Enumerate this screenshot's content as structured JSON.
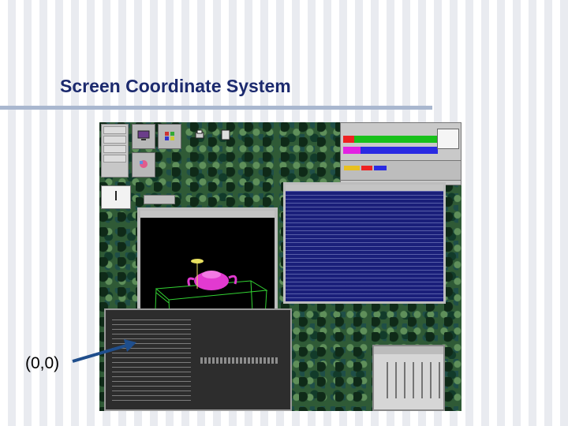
{
  "slide": {
    "title": "Screen Coordinate System",
    "origin_label": "(0,0)"
  },
  "colors": {
    "title": "#1c2a6e",
    "rule": "#a9b7cf",
    "arrow": "#1f4e8c",
    "teapot": "#e23ad0",
    "wireframe": "#32d232",
    "terminal_blue": "#1a1f7a"
  },
  "desktop": {
    "tool_icons": [
      "monitor-icon",
      "palette-icon",
      "printer-icon",
      "clipboard-icon",
      "paint-icon"
    ],
    "windows": [
      "xterm-blue",
      "opengl-teapot",
      "xterm-grey",
      "calendar",
      "status-meters"
    ]
  }
}
